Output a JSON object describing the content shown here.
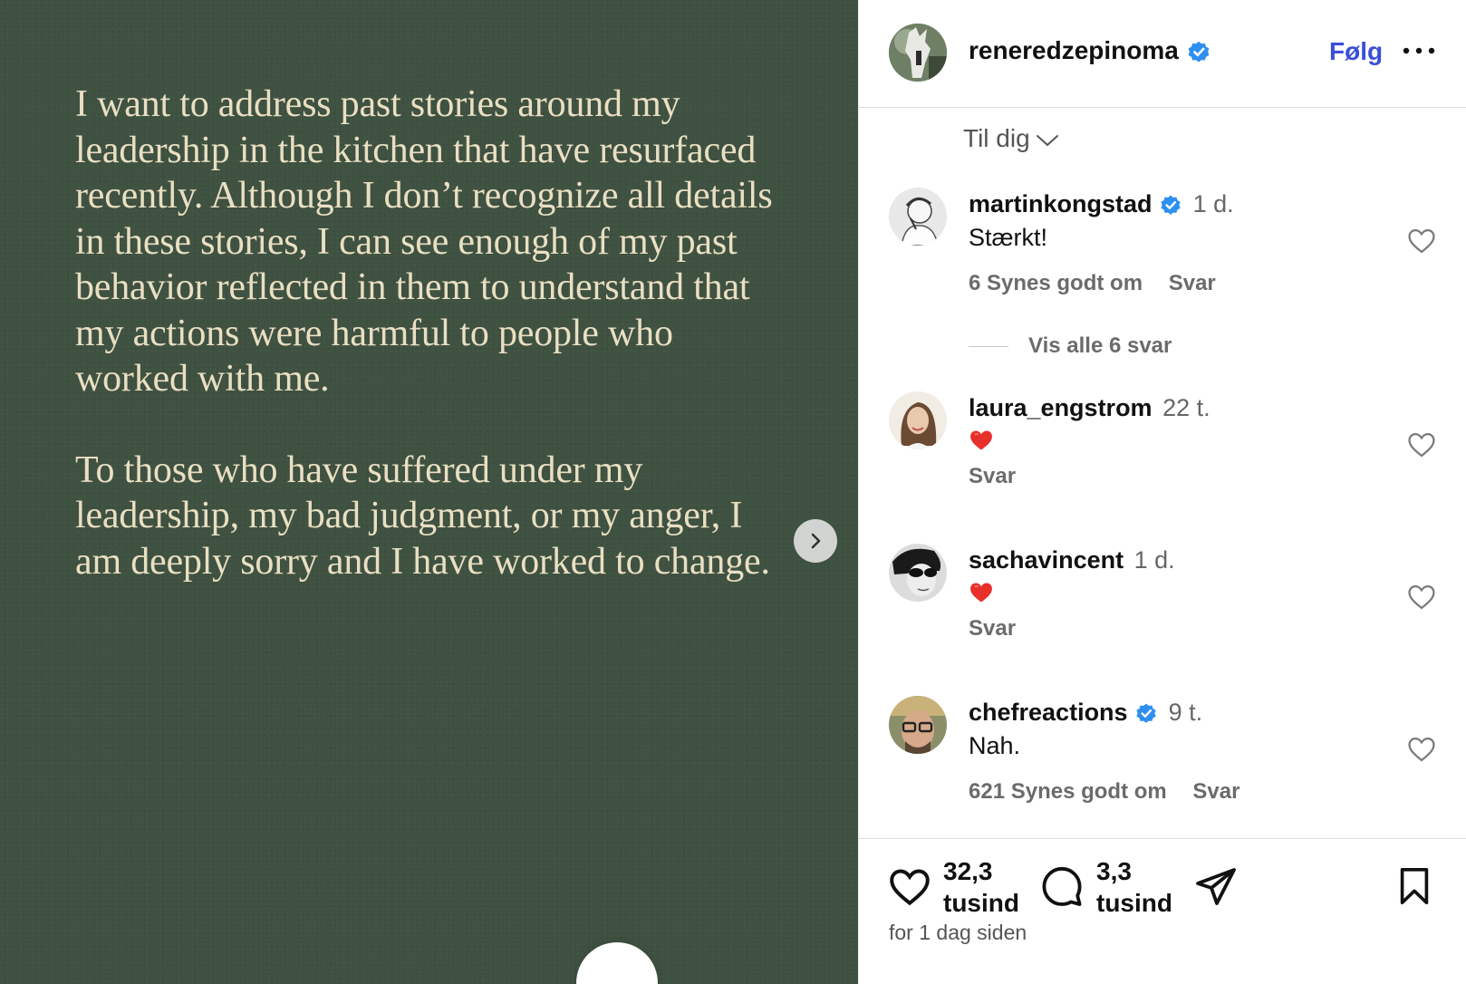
{
  "post": {
    "paragraphs": [
      "I want to address past stories around my leadership in the kitchen that have resurfaced recently. Although I don’t recognize all details in these stories, I can see enough of my past behavior reflected in them to understand that my actions were harmful to people who worked with me.",
      "To those who have suffered under my leadership, my bad judgment, or my anger, I am deeply sorry and I have worked to change."
    ]
  },
  "header": {
    "username": "reneredzepinoma",
    "follow_label": "Følg"
  },
  "sort": {
    "label": "Til dig"
  },
  "comments": [
    {
      "username": "martinkongstad",
      "verified": true,
      "time": "1 d.",
      "text": "Stærkt!",
      "likes": "6 Synes godt om",
      "reply": "Svar"
    },
    {
      "username": "laura_engstrom",
      "verified": false,
      "time": "22 t.",
      "text": "❤️",
      "likes": "",
      "reply": "Svar"
    },
    {
      "username": "sachavincent",
      "verified": false,
      "time": "1 d.",
      "text": "❤️",
      "likes": "",
      "reply": "Svar"
    },
    {
      "username": "chefreactions",
      "verified": true,
      "time": "9 t.",
      "text": "Nah.",
      "likes": "621 Synes godt om",
      "reply": "Svar"
    }
  ],
  "view_replies": "Vis alle 6 svar",
  "footer": {
    "like_count_1": "32,3",
    "like_count_2": "tusind",
    "comment_count_1": "3,3",
    "comment_count_2": "tusind",
    "timestamp": "for 1 dag siden"
  },
  "colors": {
    "media_bg": "#3f5140",
    "media_text": "#e9dfc3",
    "follow": "#3a4fd7",
    "verified": "#2f8ff0"
  },
  "icons": [
    "verified-badge-icon",
    "more-icon",
    "chevron-down-icon",
    "heart-icon",
    "comment-icon",
    "share-icon",
    "bookmark-icon",
    "chevron-right-icon"
  ]
}
